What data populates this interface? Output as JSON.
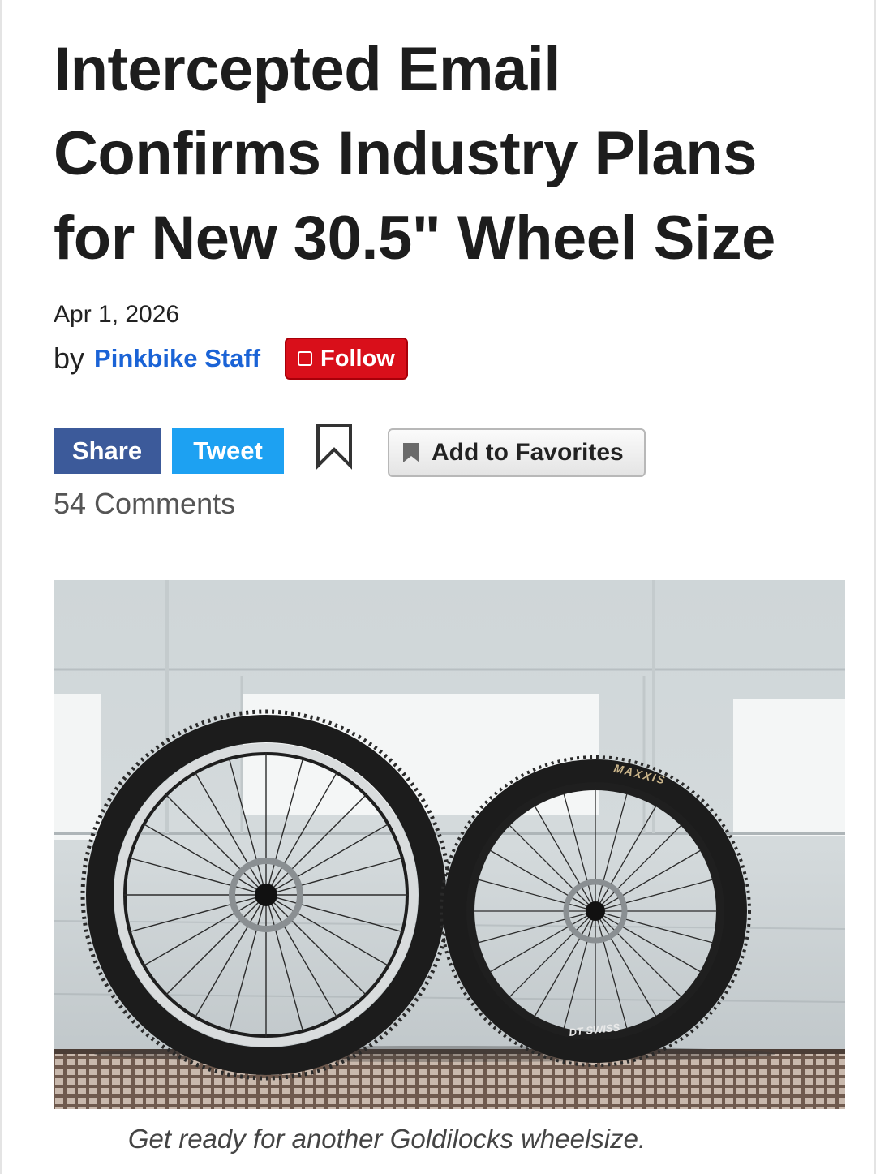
{
  "article": {
    "title": "Intercepted Email Confirms Industry Plans for New 30.5\" Wheel Size",
    "date": "Apr 1, 2026",
    "by_prefix": "by",
    "author": "Pinkbike Staff",
    "follow_label": "Follow",
    "comments": "54 Comments",
    "caption": "Get ready for another Goldilocks wheelsize."
  },
  "share": {
    "share_label": "Share",
    "tweet_label": "Tweet",
    "favorites_label": "Add to Favorites"
  },
  "photo": {
    "tire_brand": "MAXXIS",
    "rim_brand": "DT SWISS"
  },
  "colors": {
    "follow": "#d90f1a",
    "facebook": "#3c5a9a",
    "twitter": "#1da1f2",
    "author_link": "#1a63d6"
  }
}
